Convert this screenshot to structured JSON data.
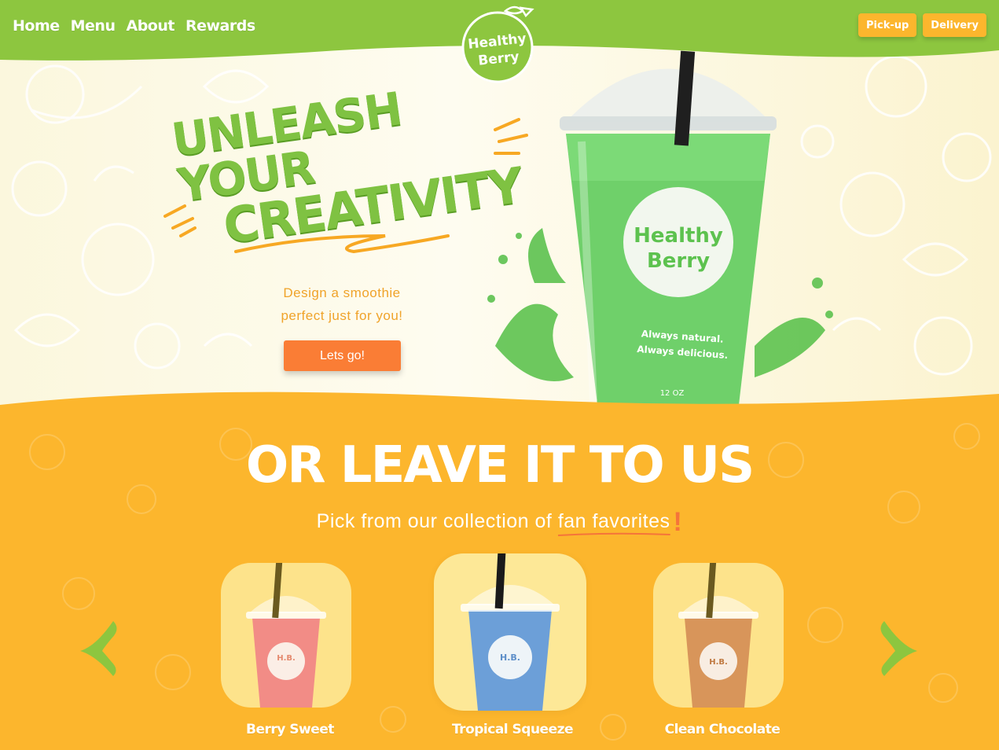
{
  "nav": {
    "items": [
      {
        "label": "Home"
      },
      {
        "label": "Menu"
      },
      {
        "label": "About"
      },
      {
        "label": "Rewards"
      }
    ],
    "pickup_label": "Pick-up",
    "delivery_label": "Delivery"
  },
  "logo": {
    "line1": "Healthy",
    "line2": "Berry"
  },
  "hero": {
    "headline_line1": "UNLEASH YOUR",
    "headline_line2": "CREATIVITY",
    "tagline_line1": "Design a smoothie",
    "tagline_line2": "perfect just for you!",
    "cta_label": "Lets go!",
    "cup": {
      "brand_line1": "Healthy",
      "brand_line2": "Berry",
      "slogan_line1": "Always natural.",
      "slogan_line2": "Always delicious.",
      "size": "12 OZ"
    }
  },
  "favorites": {
    "title": "OR LEAVE IT TO US",
    "subtitle_prefix": "Pick from our collection of ",
    "subtitle_highlight": "fan favorites",
    "subtitle_bang": "!",
    "items": [
      {
        "name": "Berry Sweet",
        "color": "#f28c86"
      },
      {
        "name": "Tropical Squeeze",
        "color": "#6c9fd8"
      },
      {
        "name": "Clean Chocolate",
        "color": "#d8955a"
      }
    ]
  },
  "colors": {
    "green": "#8dc63f",
    "orange": "#fcb62d",
    "cta": "#fa7d35",
    "headline": "#7fc242"
  }
}
